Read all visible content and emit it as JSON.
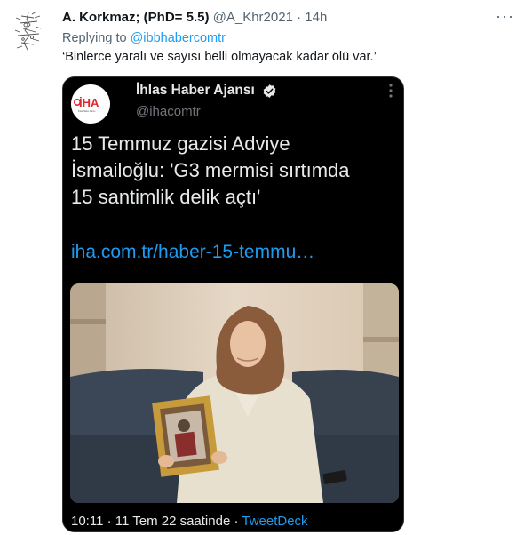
{
  "tweet": {
    "author_name": "A. Korkmaz; (PhD= 5.5)",
    "author_handle": "@A_Khr2021",
    "separator": "·",
    "time": "14h",
    "replying_label": "Replying to",
    "replying_handle": "@ibbhabercomtr",
    "text": "‘Binlerce yaralı ve sayısı belli olmayacak kadar ölü var.’",
    "more_glyph": "···"
  },
  "embed": {
    "logo_text": "İHA",
    "logo_subtext": "İhlas Haber Ajansı",
    "author_name": "İhlas Haber Ajansı",
    "author_handle": "@ihacomtr",
    "body_lines": [
      "15 Temmuz gazisi Adviye",
      "İsmailoğlu: 'G3 mermisi sırtımda",
      "15 santimlik delik açtı'"
    ],
    "link": "iha.com.tr/haber-15-temmu…",
    "footer_time": "10:11 · 11 Tem 22 saatinde ·",
    "footer_via": "TweetDeck"
  },
  "colors": {
    "accent": "#1d9bf0",
    "embed_bg": "#000000",
    "muted": "#536471",
    "logo_red": "#e1262d"
  }
}
